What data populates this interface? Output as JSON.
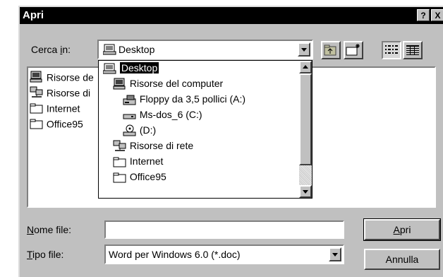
{
  "window": {
    "title": "Apri",
    "help_button": "?",
    "close_button": "X"
  },
  "look_in": {
    "label_pre": "Cerca ",
    "label_key": "i",
    "label_post": "n:",
    "value": "Desktop"
  },
  "file_list": {
    "items": [
      {
        "label": "Risorse de",
        "icon": "computer-icon"
      },
      {
        "label": "Risorse di",
        "icon": "network-icon"
      },
      {
        "label": "Internet",
        "icon": "folder-icon"
      },
      {
        "label": "Office95",
        "icon": "folder-icon"
      }
    ]
  },
  "dropdown": {
    "items": [
      {
        "label": "Desktop",
        "icon": "desktop-icon",
        "selected": true
      },
      {
        "label": "Risorse del computer",
        "icon": "computer-icon"
      },
      {
        "label": "Floppy da 3,5 pollici (A:)",
        "icon": "floppy-icon"
      },
      {
        "label": "Ms-dos_6 (C:)",
        "icon": "hard-drive-icon"
      },
      {
        "label": "(D:)",
        "icon": "cdrom-icon"
      },
      {
        "label": "Risorse di rete",
        "icon": "network-icon"
      },
      {
        "label": "Internet",
        "icon": "folder-icon"
      },
      {
        "label": "Office95",
        "icon": "folder-icon"
      }
    ]
  },
  "filename": {
    "label_key": "N",
    "label_post": "ome file:",
    "value": ""
  },
  "filetype": {
    "label_key": "T",
    "label_post": "ipo file:",
    "value": "Word per Windows 6.0 (*.doc)"
  },
  "buttons": {
    "open_key": "A",
    "open_post": "pri",
    "cancel": "Annulla"
  }
}
